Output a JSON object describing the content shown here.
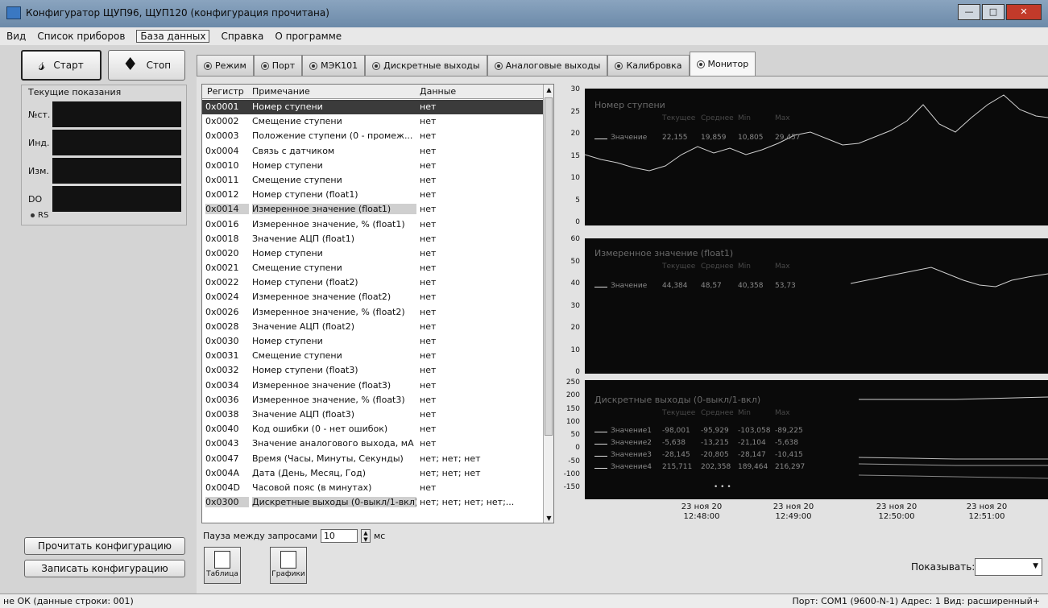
{
  "window": {
    "title": "Конфигуратор ЩУП96, ЩУП120 (конфигурация прочитана)"
  },
  "menu": [
    "Вид",
    "Список приборов",
    "База данных",
    "Справка",
    "О программе"
  ],
  "controls": {
    "start": "Старт",
    "stop": "Стоп"
  },
  "readings": {
    "header": "Текущие показания",
    "rows": [
      "№ст.",
      "Инд.",
      "Изм.",
      "DO"
    ],
    "rs": "RS"
  },
  "left_buttons": {
    "read": "Прочитать конфигурацию",
    "write": "Записать конфигурацию"
  },
  "tabs": [
    "Режим",
    "Порт",
    "МЭК101",
    "Дискретные выходы",
    "Аналоговые выходы",
    "Калибровка",
    "Монитор"
  ],
  "table": {
    "headers": [
      "Регистр",
      "Примечание",
      "Данные"
    ],
    "rows": [
      [
        "0x0001",
        "Номер ступени",
        "нет"
      ],
      [
        "0x0002",
        "Смещение ступени",
        "нет"
      ],
      [
        "0x0003",
        "Положение ступени (0 - промеж...",
        "нет"
      ],
      [
        "0x0004",
        "Связь с датчиком",
        "нет"
      ],
      [
        "0x0010",
        "Номер ступени",
        "нет"
      ],
      [
        "0x0011",
        "Смещение ступени",
        "нет"
      ],
      [
        "0x0012",
        "Номер ступени (float1)",
        "нет"
      ],
      [
        "0x0014",
        "Измеренное значение (float1)",
        "нет"
      ],
      [
        "0x0016",
        "Измеренное значение, % (float1)",
        "нет"
      ],
      [
        "0x0018",
        "Значение АЦП (float1)",
        "нет"
      ],
      [
        "0x0020",
        "Номер ступени",
        "нет"
      ],
      [
        "0x0021",
        "Смещение ступени",
        "нет"
      ],
      [
        "0x0022",
        "Номер ступени (float2)",
        "нет"
      ],
      [
        "0x0024",
        "Измеренное значение (float2)",
        "нет"
      ],
      [
        "0x0026",
        "Измеренное значение, % (float2)",
        "нет"
      ],
      [
        "0x0028",
        "Значение АЦП (float2)",
        "нет"
      ],
      [
        "0x0030",
        "Номер ступени",
        "нет"
      ],
      [
        "0x0031",
        "Смещение ступени",
        "нет"
      ],
      [
        "0x0032",
        "Номер ступени (float3)",
        "нет"
      ],
      [
        "0x0034",
        "Измеренное значение (float3)",
        "нет"
      ],
      [
        "0x0036",
        "Измеренное значение, % (float3)",
        "нет"
      ],
      [
        "0x0038",
        "Значение АЦП (float3)",
        "нет"
      ],
      [
        "0x0040",
        "Код ошибки (0 - нет ошибок)",
        "нет"
      ],
      [
        "0x0043",
        "Значение аналогового выхода, мА",
        "нет"
      ],
      [
        "0x0047",
        "Время (Часы, Минуты, Секунды)",
        "нет; нет; нет"
      ],
      [
        "0x004A",
        "Дата (День, Месяц, Год)",
        "нет; нет; нет"
      ],
      [
        "0x004D",
        "Часовой пояс (в минутах)",
        "нет"
      ],
      [
        "0x0300",
        "Дискретные выходы (0-выкл/1-вкл)",
        "нет; нет; нет; нет;..."
      ]
    ]
  },
  "pause": {
    "label": "Пауза между запросами",
    "value": "10",
    "unit": "мс"
  },
  "views": {
    "table": "Таблица",
    "graphs": "Графики"
  },
  "charts": {
    "c1": {
      "title": "Номер ступени",
      "heads": [
        "Текущее",
        "Среднее",
        "Min",
        "Max"
      ],
      "series": [
        {
          "name": "Значение",
          "vals": [
            "22,155",
            "19,859",
            "10,805",
            "29,457"
          ]
        }
      ],
      "yticks": [
        "30",
        "25",
        "20",
        "15",
        "10",
        "5",
        "0"
      ]
    },
    "c2": {
      "title": "Измеренное значение (float1)",
      "heads": [
        "Текущее",
        "Среднее",
        "Min",
        "Max"
      ],
      "series": [
        {
          "name": "Значение",
          "vals": [
            "44,384",
            "48,57",
            "40,358",
            "53,73"
          ]
        }
      ],
      "yticks": [
        "60",
        "50",
        "40",
        "30",
        "20",
        "10",
        "0"
      ]
    },
    "c3": {
      "title": "Дискретные выходы (0-выкл/1-вкл)",
      "heads": [
        "Текущее",
        "Среднее",
        "Min",
        "Max"
      ],
      "series": [
        {
          "name": "Значение1",
          "vals": [
            "-98,001",
            "-95,929",
            "-103,058",
            "-89,225"
          ]
        },
        {
          "name": "Значение2",
          "vals": [
            "-5,638",
            "-13,215",
            "-21,104",
            "-5,638"
          ]
        },
        {
          "name": "Значение3",
          "vals": [
            "-28,145",
            "-20,805",
            "-28,147",
            "-10,415"
          ]
        },
        {
          "name": "Значение4",
          "vals": [
            "215,711",
            "202,358",
            "189,464",
            "216,297"
          ]
        }
      ],
      "more": "• • •",
      "yticks": [
        "250",
        "200",
        "150",
        "100",
        "50",
        "0",
        "-50",
        "-100",
        "-150"
      ]
    },
    "xlabels": [
      "23 ноя 20\n12:48:00",
      "23 ноя 20\n12:49:00",
      "23 ноя 20\n12:50:00",
      "23 ноя 20\n12:51:00"
    ]
  },
  "show": {
    "label": "Показывать:"
  },
  "status": {
    "left": "не ОК (данные строки: 001)",
    "right": "Порт: COM1 (9600-N-1)   Адрес: 1   Вид: расширенный+"
  }
}
